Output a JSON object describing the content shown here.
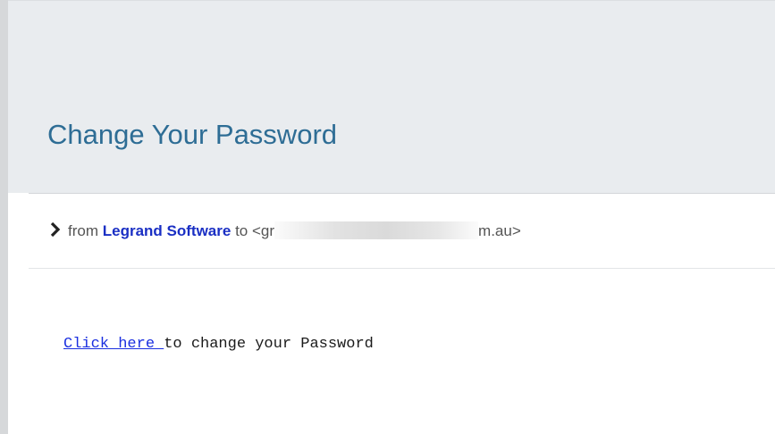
{
  "email": {
    "subject": "Change Your Password",
    "sender_line": {
      "from_label": "from",
      "sender_name": "Legrand Software",
      "to_label": "to",
      "recipient_start": "<gr",
      "recipient_end": "m.au>"
    },
    "body": {
      "link_text": "Click here ",
      "rest_text": "to change your Password"
    }
  },
  "icons": {
    "expand": "chevron-right-icon"
  },
  "colors": {
    "subject": "#2e6d95",
    "sender_name": "#1a2fc4",
    "link": "#1a2fe0",
    "header_background": "#e9ecef"
  }
}
